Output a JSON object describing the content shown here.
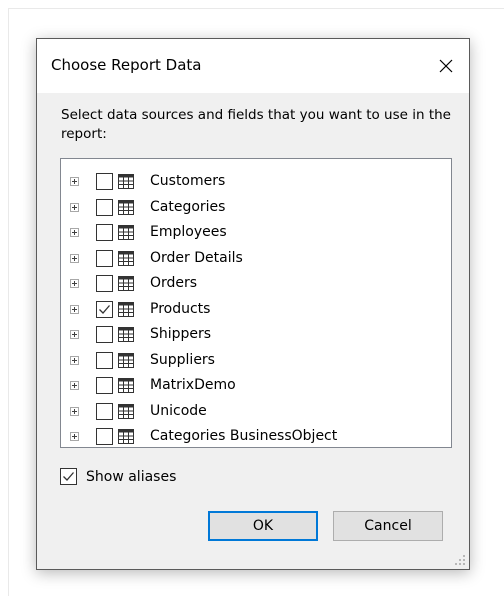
{
  "dialog": {
    "title": "Choose Report Data",
    "instructions": "Select data sources and fields that you want to use in the report:",
    "tree_items": [
      {
        "label": "Customers",
        "checked": false
      },
      {
        "label": "Categories",
        "checked": false
      },
      {
        "label": "Employees",
        "checked": false
      },
      {
        "label": "Order Details",
        "checked": false
      },
      {
        "label": "Orders",
        "checked": false
      },
      {
        "label": "Products",
        "checked": true
      },
      {
        "label": "Shippers",
        "checked": false
      },
      {
        "label": "Suppliers",
        "checked": false
      },
      {
        "label": "MatrixDemo",
        "checked": false
      },
      {
        "label": "Unicode",
        "checked": false
      },
      {
        "label": "Categories BusinessObject",
        "checked": false
      }
    ],
    "show_aliases": {
      "label": "Show aliases",
      "checked": true
    },
    "ok_label": "OK",
    "cancel_label": "Cancel"
  },
  "icons": {
    "close": "close-icon",
    "expander": "plus-box-icon",
    "table": "table-icon",
    "check": "checkmark-icon",
    "grip": "resize-grip-icon"
  },
  "colors": {
    "dialog_bg": "#f0f0f0",
    "default_button_border": "#0078d7"
  }
}
